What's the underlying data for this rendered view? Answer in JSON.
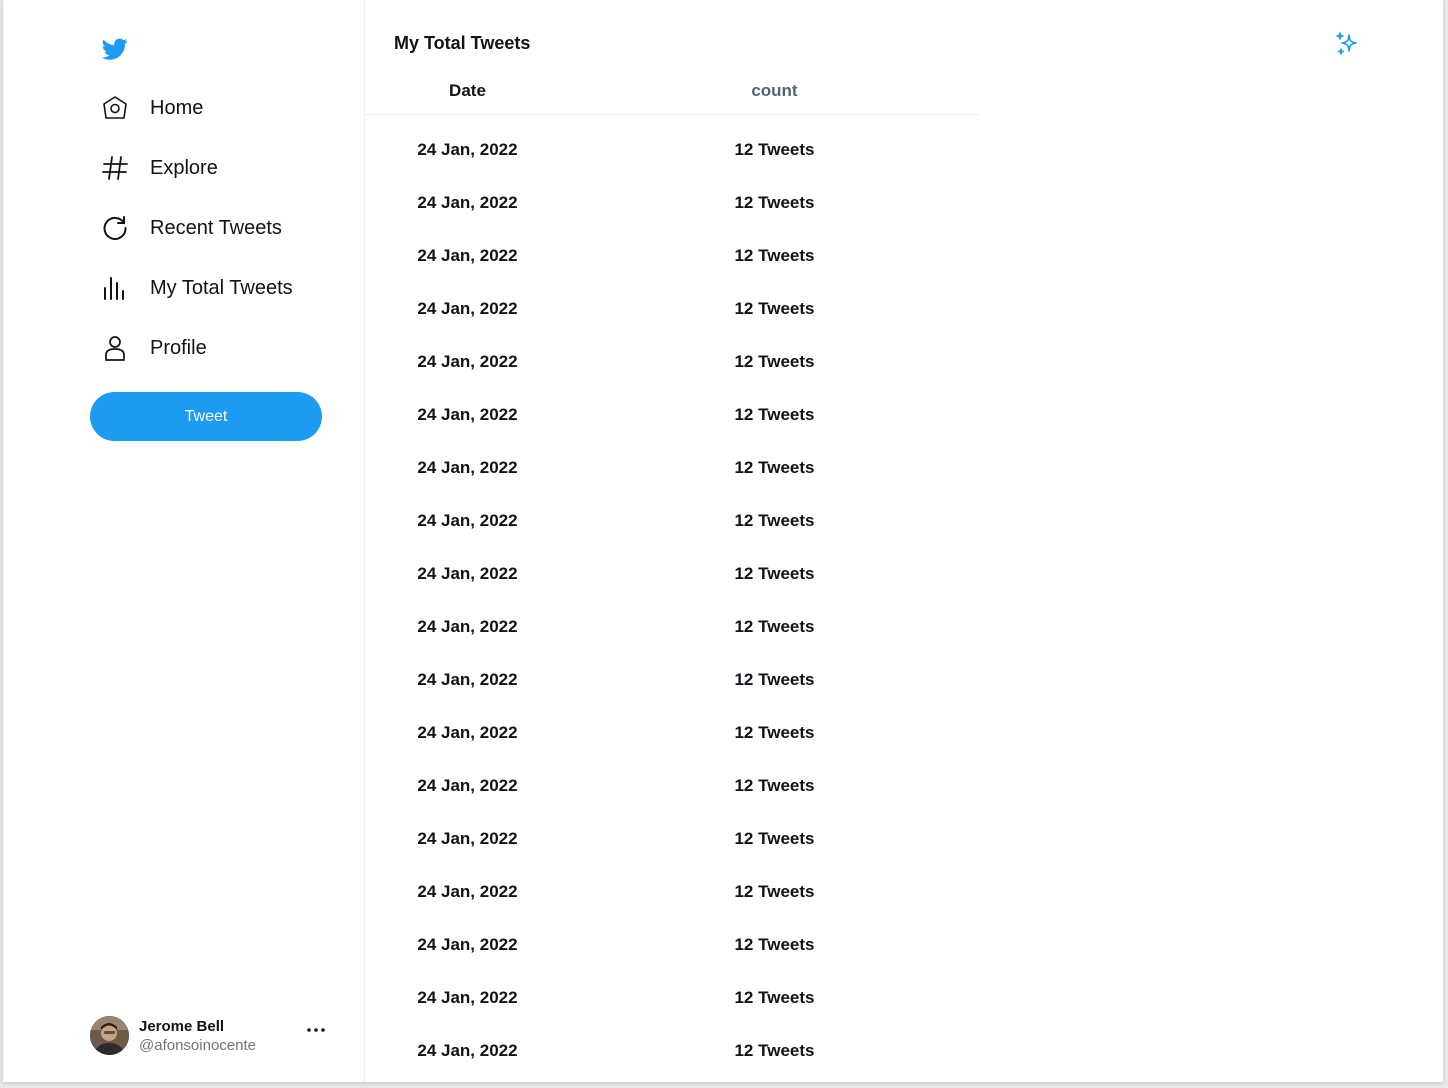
{
  "colors": {
    "accent": "#1d9bf0",
    "text": "#0f1419",
    "muted": "#536471"
  },
  "sidebar": {
    "logo_icon": "twitter-bird-icon",
    "items": [
      {
        "label": "Home",
        "icon": "home-icon"
      },
      {
        "label": "Explore",
        "icon": "hashtag-icon"
      },
      {
        "label": "Recent Tweets",
        "icon": "refresh-icon"
      },
      {
        "label": "My Total Tweets",
        "icon": "bar-chart-icon"
      },
      {
        "label": "Profile",
        "icon": "person-icon"
      }
    ],
    "tweet_button": "Tweet",
    "account": {
      "name": "Jerome Bell",
      "handle": "@afonsoinocente"
    }
  },
  "main": {
    "title": "My Total Tweets",
    "columns": {
      "date": "Date",
      "count": "count"
    },
    "rows": [
      {
        "date": "24 Jan, 2022",
        "count": "12 Tweets"
      },
      {
        "date": "24 Jan, 2022",
        "count": "12 Tweets"
      },
      {
        "date": "24 Jan, 2022",
        "count": "12 Tweets"
      },
      {
        "date": "24 Jan, 2022",
        "count": "12 Tweets"
      },
      {
        "date": "24 Jan, 2022",
        "count": "12 Tweets"
      },
      {
        "date": "24 Jan, 2022",
        "count": "12 Tweets"
      },
      {
        "date": "24 Jan, 2022",
        "count": "12 Tweets"
      },
      {
        "date": "24 Jan, 2022",
        "count": "12 Tweets"
      },
      {
        "date": "24 Jan, 2022",
        "count": "12 Tweets"
      },
      {
        "date": "24 Jan, 2022",
        "count": "12 Tweets"
      },
      {
        "date": "24 Jan, 2022",
        "count": "12 Tweets"
      },
      {
        "date": "24 Jan, 2022",
        "count": "12 Tweets"
      },
      {
        "date": "24 Jan, 2022",
        "count": "12 Tweets"
      },
      {
        "date": "24 Jan, 2022",
        "count": "12 Tweets"
      },
      {
        "date": "24 Jan, 2022",
        "count": "12 Tweets"
      },
      {
        "date": "24 Jan, 2022",
        "count": "12 Tweets"
      },
      {
        "date": "24 Jan, 2022",
        "count": "12 Tweets"
      },
      {
        "date": "24 Jan, 2022",
        "count": "12 Tweets"
      }
    ]
  }
}
